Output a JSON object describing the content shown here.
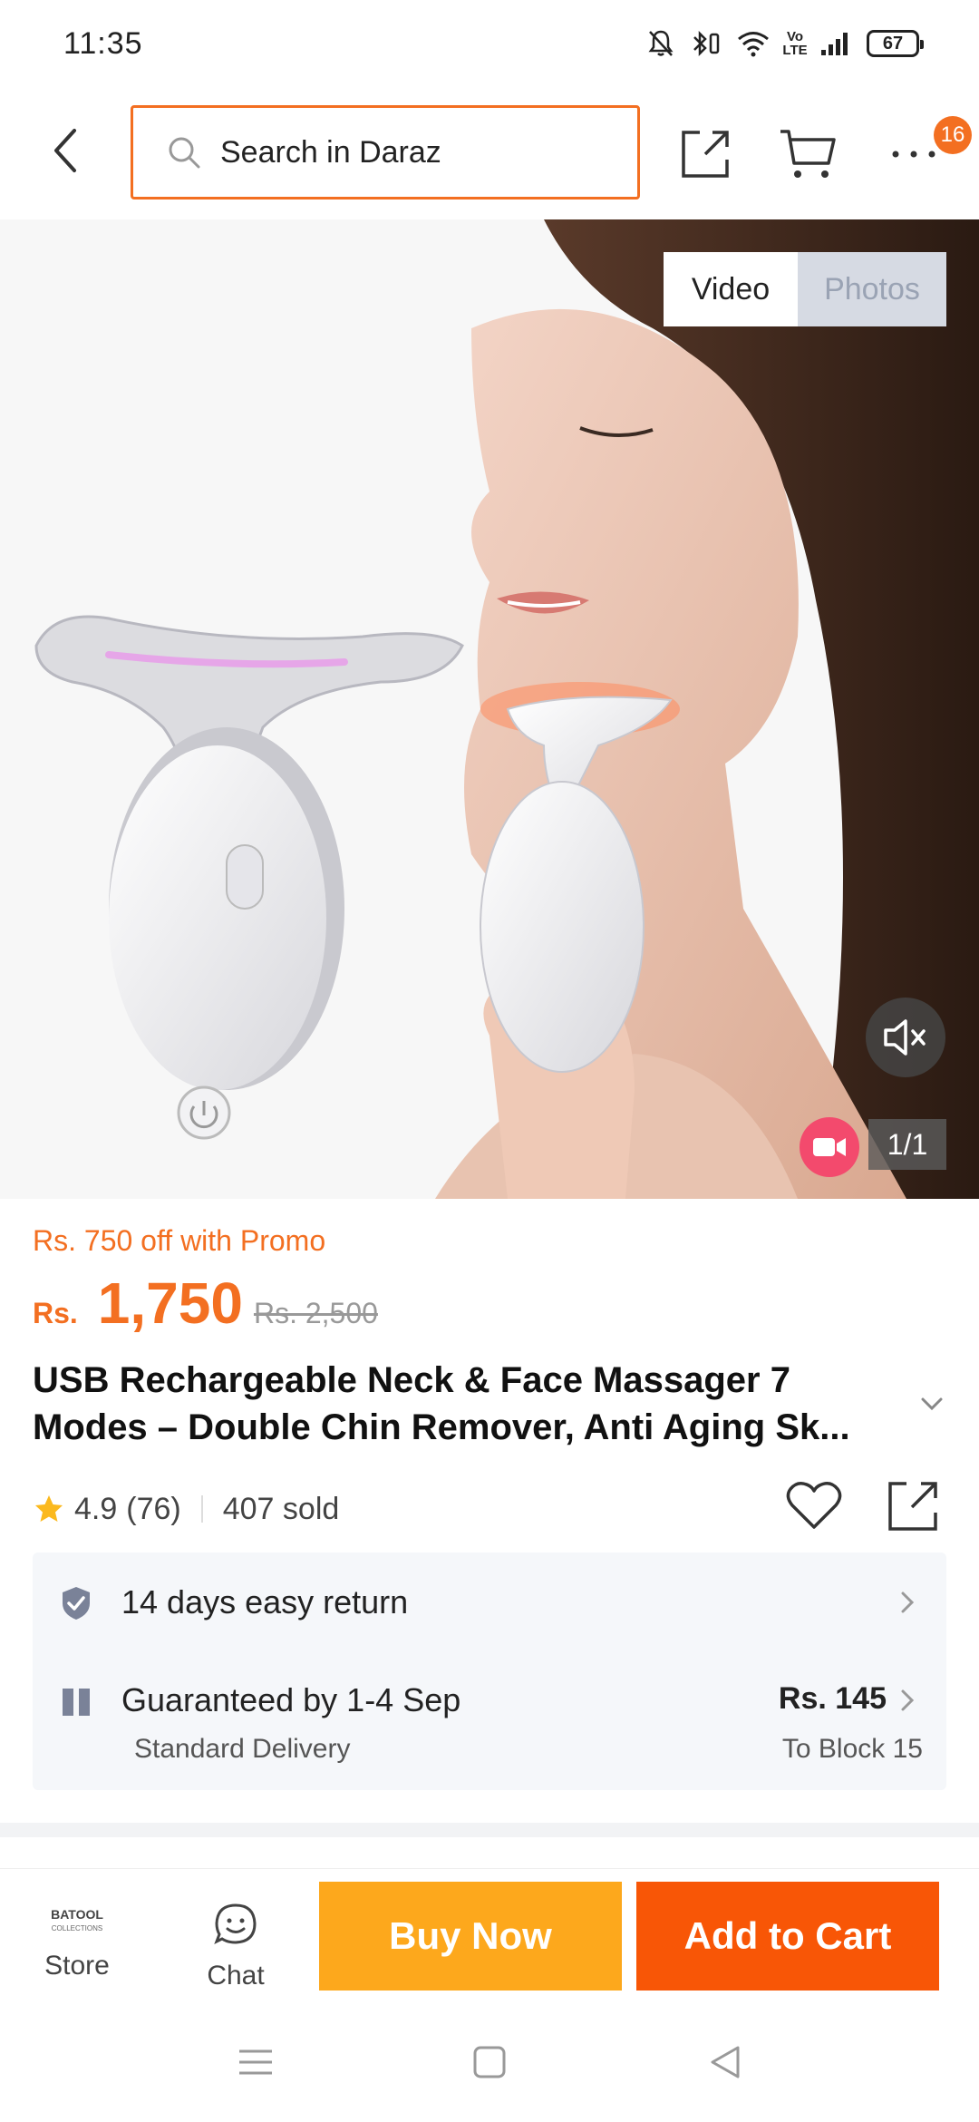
{
  "status_bar": {
    "time": "11:35",
    "battery": "67",
    "network_label": "Vo LTE",
    "icons": [
      "mute-bell-icon",
      "bluetooth-icon",
      "wifi-icon",
      "signal-icon",
      "battery-icon"
    ]
  },
  "top_nav": {
    "search_placeholder": "Search in Daraz",
    "more_badge_count": "16",
    "icons": [
      "back-arrow-icon",
      "search-icon",
      "share-icon",
      "cart-icon",
      "more-dots-icon"
    ]
  },
  "media": {
    "tabs": [
      {
        "label": "Video",
        "active": true
      },
      {
        "label": "Photos",
        "active": false
      }
    ],
    "counter": "1/1",
    "icons": [
      "mute-speaker-icon",
      "video-camera-icon"
    ]
  },
  "product": {
    "promo_text": "Rs. 750 off with Promo",
    "currency": "Rs.",
    "price": "1,750",
    "original_price": "Rs. 2,500",
    "title_line1": "USB Rechargeable Neck & Face Massager 7",
    "title_line2": "Modes – Double Chin Remover, Anti Aging Sk...",
    "rating": "4.9",
    "rating_count": "(76)",
    "sold": "407 sold"
  },
  "delivery": {
    "return_text": "14 days easy return",
    "guarantee_text": "Guaranteed by 1-4 Sep",
    "delivery_type": "Standard Delivery",
    "fee": "Rs. 145",
    "destination": "To Block 15"
  },
  "action_bar": {
    "store_logo_text": "BATOOL",
    "store_logo_sub": "COLLECTIONS",
    "store_label": "Store",
    "chat_label": "Chat",
    "buy_now": "Buy Now",
    "add_to_cart": "Add to Cart"
  },
  "colors": {
    "accent": "#f36f21",
    "buy_now": "#fda81c",
    "add_to_cart": "#f85606",
    "star": "#fbb91e"
  }
}
